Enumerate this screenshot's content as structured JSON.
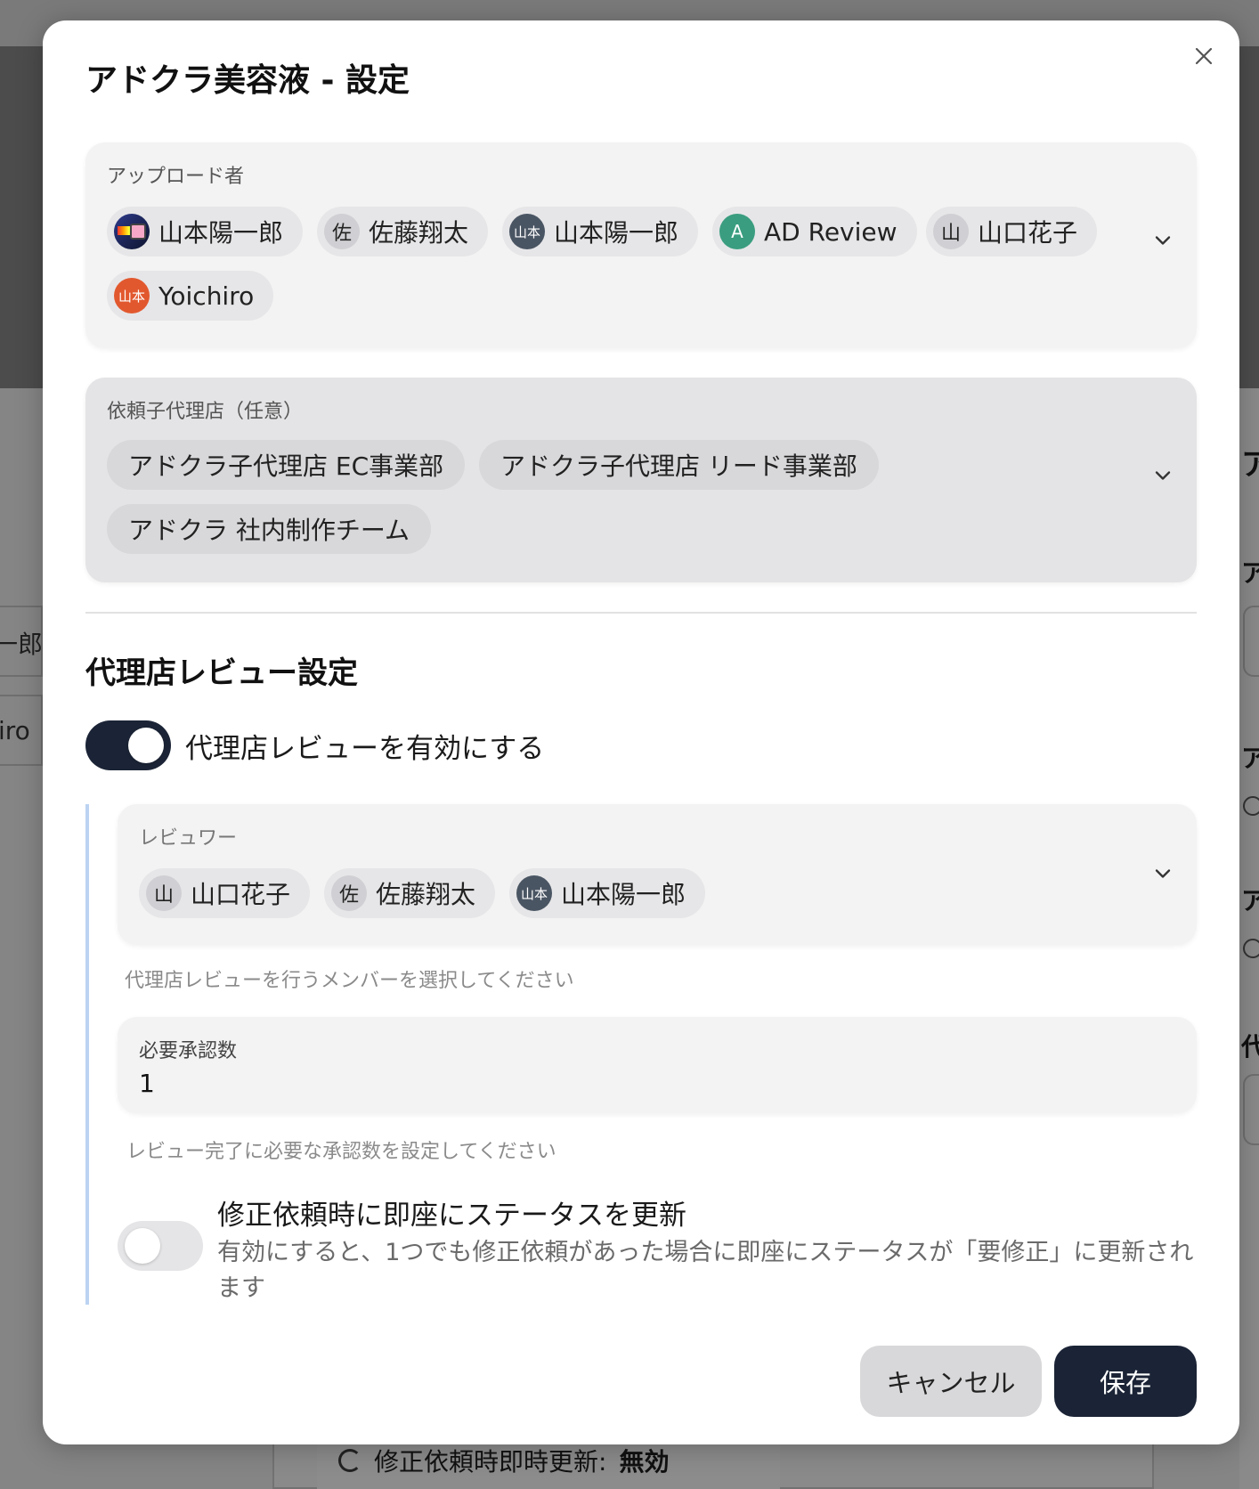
{
  "background": {
    "left_texts": [
      "一郎",
      "iro"
    ],
    "right_glyphs": [
      "ア",
      "ア",
      "ア",
      "ア",
      "代"
    ],
    "footer": {
      "label": "修正依頼時即時更新:",
      "value": "無効"
    }
  },
  "modal": {
    "title": "アドクラ美容液 - 設定",
    "uploaders": {
      "label": "アップロード者",
      "chips": [
        {
          "name": "山本陽一郎",
          "avatar": ""
        },
        {
          "name": "佐藤翔太",
          "avatar": "佐"
        },
        {
          "name": "山本陽一郎",
          "avatar": "山本"
        },
        {
          "name": "AD Review",
          "avatar": "A"
        },
        {
          "name": "山口花子",
          "avatar": "山"
        },
        {
          "name": "Yoichiro",
          "avatar": "山本"
        }
      ]
    },
    "subagencies": {
      "label": "依頼子代理店（任意）",
      "chips": [
        "アドクラ子代理店 EC事業部",
        "アドクラ子代理店 リード事業部",
        "アドクラ 社内制作チーム"
      ]
    },
    "review_section": {
      "title": "代理店レビュー設定",
      "enable_label": "代理店レビューを有効にする",
      "enabled": true,
      "reviewers": {
        "label": "レビュワー",
        "chips": [
          {
            "name": "山口花子",
            "avatar": "山"
          },
          {
            "name": "佐藤翔太",
            "avatar": "佐"
          },
          {
            "name": "山本陽一郎",
            "avatar": "山本"
          }
        ],
        "helper": "代理店レビューを行うメンバーを選択してください"
      },
      "required_approvals": {
        "label": "必要承認数",
        "value": "1",
        "helper": "レビュー完了に必要な承認数を設定してください"
      },
      "immediate_update": {
        "label": "修正依頼時に即座にステータスを更新",
        "description": "有効にすると、1つでも修正依頼があった場合に即座にステータスが「要修正」に更新されます",
        "enabled": false
      }
    },
    "buttons": {
      "cancel": "キャンセル",
      "save": "保存"
    }
  },
  "colors": {
    "primary": "#1b2436",
    "accent_rule": "#bcd4f2",
    "avatar_teal": "#3a9d7f",
    "avatar_orange": "#e2582e",
    "avatar_slate": "#4a5563"
  }
}
